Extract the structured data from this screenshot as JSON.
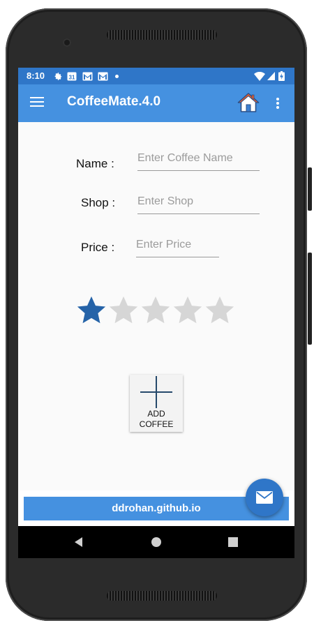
{
  "status_bar": {
    "time": "8:10",
    "calendar_day": "31",
    "icons": [
      "gear-icon",
      "calendar-icon",
      "gmail-icon",
      "gmail-icon",
      "notification-dot-icon",
      "wifi-icon",
      "signal-icon",
      "battery-charging-icon"
    ]
  },
  "app_bar": {
    "title": "CoffeeMate.4.0",
    "icons": [
      "menu-icon",
      "home-icon",
      "more-options-icon"
    ]
  },
  "form": {
    "name_label": "Name :",
    "name_placeholder": "Enter Coffee Name",
    "shop_label": "Shop :",
    "shop_placeholder": "Enter Shop",
    "price_label": "Price :",
    "price_placeholder": "Enter Price"
  },
  "rating": {
    "value": 1,
    "max": 5,
    "filled_color": "#2563a8",
    "empty_color": "#d6d6d6"
  },
  "add_button": {
    "line1": "ADD",
    "line2": "COFFEE"
  },
  "footer": {
    "text": "ddrohan.github.io"
  },
  "fab": {
    "icon": "email-icon"
  },
  "nav_bar": {
    "icons": [
      "back-icon",
      "home-nav-icon",
      "recents-icon"
    ]
  },
  "colors": {
    "status_bar": "#2f76c8",
    "app_bar": "#4591e0",
    "accent": "#2f76c8"
  }
}
